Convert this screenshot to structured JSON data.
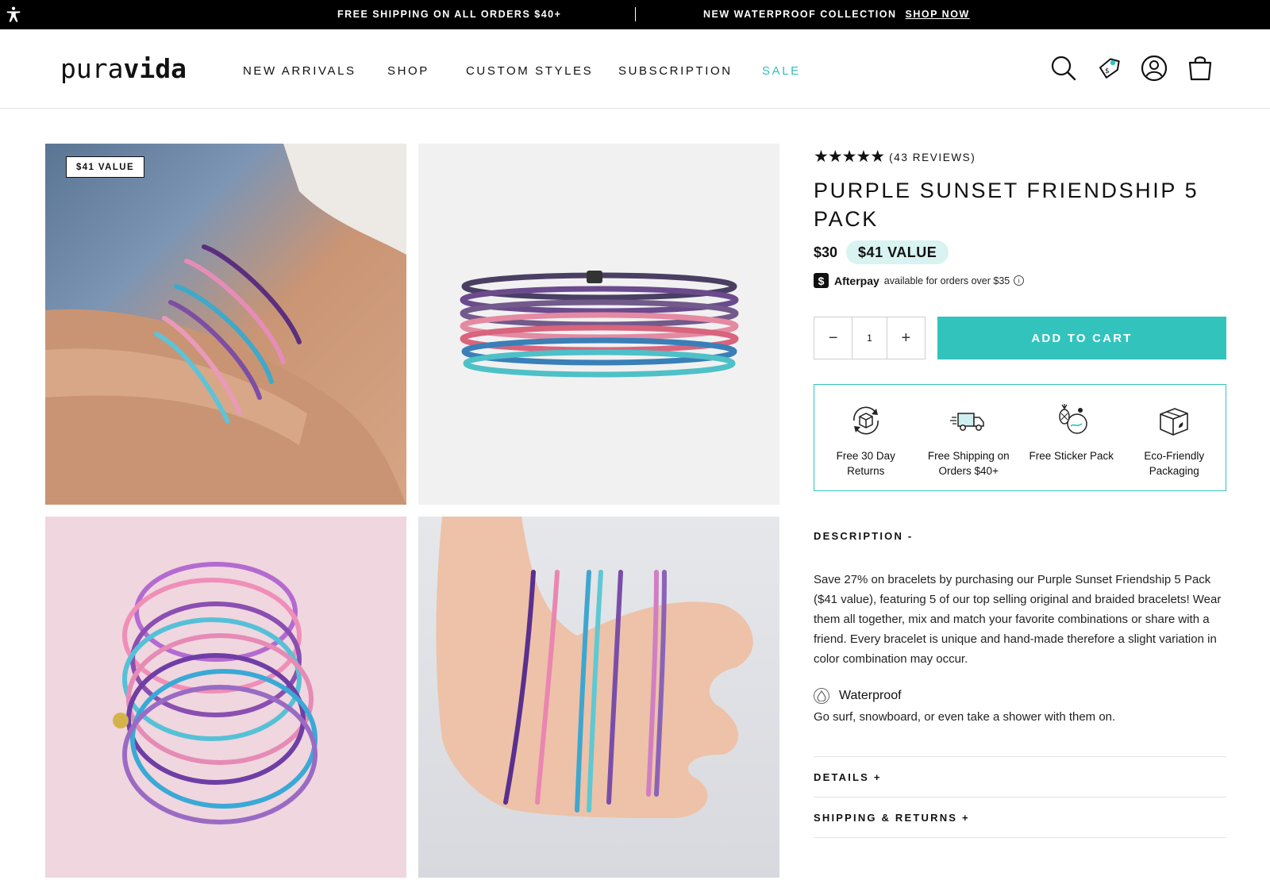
{
  "announcement": {
    "left_text": "FREE SHIPPING ON ALL ORDERS $40+",
    "right_text": "NEW WATERPROOF COLLECTION",
    "right_link": "SHOP NOW"
  },
  "header": {
    "logo_light": "pura",
    "logo_bold": "vida",
    "nav": [
      {
        "label": "NEW ARRIVALS"
      },
      {
        "label": "SHOP"
      },
      {
        "label": "CUSTOM STYLES"
      },
      {
        "label": "SUBSCRIPTION"
      },
      {
        "label": "SALE"
      }
    ],
    "icons": [
      "search-icon",
      "price-tag-icon",
      "account-icon",
      "shopping-bag-icon"
    ],
    "sale_color": "#2ec3bd"
  },
  "gallery": {
    "badge": "$41 VALUE",
    "images": [
      "wrist-bracelets-photo",
      "stacked-bracelets-photo",
      "pink-background-bracelets-photo",
      "hand-bracelets-photo"
    ]
  },
  "product": {
    "rating": 4.5,
    "stars": "★★★★★",
    "reviews": "(43 REVIEWS)",
    "title": "PURPLE SUNSET FRIENDSHIP 5 PACK",
    "price": "$30",
    "value": "$41 VALUE",
    "afterpay": {
      "logo": "$",
      "name": "Afterpay",
      "text": "available for orders over $35",
      "info": "i"
    },
    "quantity": {
      "minus": "−",
      "value": "1",
      "plus": "+"
    },
    "add_to_cart": "ADD TO CART",
    "accent_color": "#33c3bd",
    "perks": [
      {
        "label": "Free 30 Day Returns",
        "icon": "returns-box-icon"
      },
      {
        "label": "Free Shipping on Orders $40+",
        "icon": "delivery-truck-icon"
      },
      {
        "label": "Free Sticker Pack",
        "icon": "sticker-pack-icon"
      },
      {
        "label": "Eco-Friendly Packaging",
        "icon": "eco-box-icon"
      }
    ],
    "description": {
      "heading": "DESCRIPTION -",
      "body": "Save 27% on bracelets by purchasing our Purple Sunset Friendship 5 Pack ($41 value), featuring 5 of our top selling original and braided bracelets! Wear them all together, mix and match your favorite combinations or share with a friend. Every bracelet is unique and hand-made therefore a slight variation in color combination may occur.",
      "feature_label": "Waterproof",
      "feature_text": "Go surf, snowboard, or even take a shower with them on."
    },
    "accordions": [
      {
        "label": "DETAILS +"
      },
      {
        "label": "SHIPPING & RETURNS +"
      }
    ]
  }
}
